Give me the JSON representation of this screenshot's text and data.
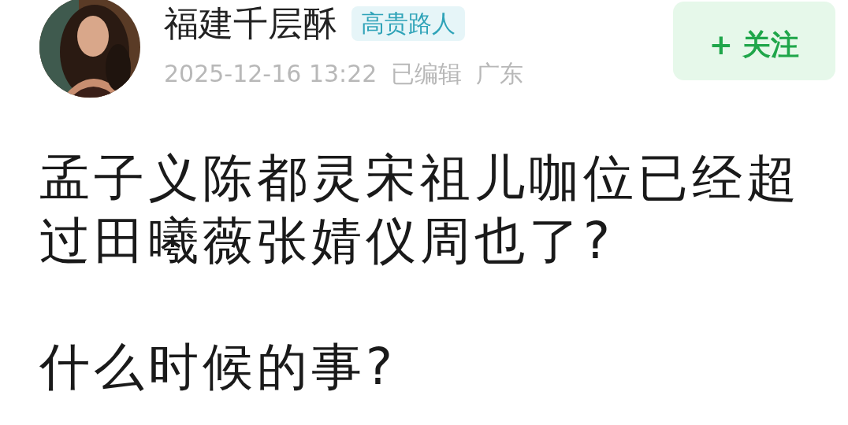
{
  "author": {
    "name": "福建千层酥",
    "badge": "高贵路人",
    "meta": [
      "2025-12-16 13:22",
      "已编辑",
      "广东"
    ]
  },
  "follow_button": {
    "label": "+ 关注"
  },
  "post": {
    "paragraphs": [
      "孟子义陈都灵宋祖儿咖位已经超过田曦薇张婧仪周也了?",
      "什么时候的事?"
    ]
  }
}
